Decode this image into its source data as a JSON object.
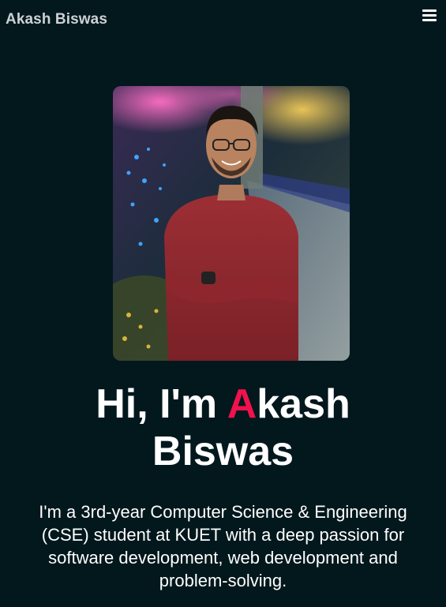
{
  "header": {
    "brand": "Akash Biswas",
    "menu_icon": "hamburger-menu-icon"
  },
  "hero": {
    "photo_icon": "profile-photo",
    "title_prefix": "Hi, I'm ",
    "title_accent_letter": "A",
    "title_rest_line1": "kash",
    "title_line2": "Biswas",
    "description": "I'm a 3rd-year Computer Science & Engineering (CSE) student at KUET with a deep passion for software development, web development and problem-solving."
  },
  "colors": {
    "background": "#02181d",
    "accent": "#f0114d",
    "text": "#ffffff",
    "brand_text": "#cdd2d6"
  }
}
